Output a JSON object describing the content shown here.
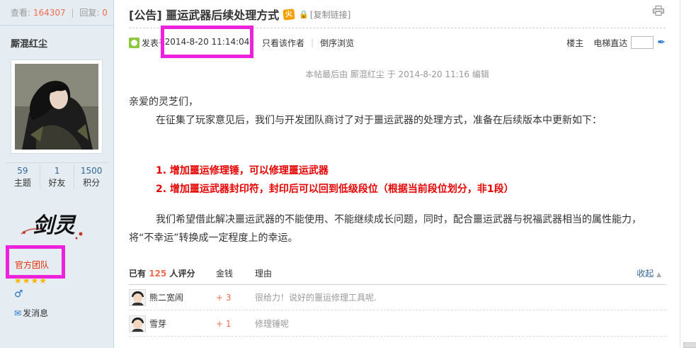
{
  "sidebar": {
    "views_label": "查看:",
    "views_value": "164307",
    "replies_label": "回复:",
    "replies_value": "0",
    "username": "厮混红尘",
    "stats": [
      {
        "value": "59",
        "label": "主题"
      },
      {
        "value": "1",
        "label": "好友"
      },
      {
        "value": "1500",
        "label": "积分"
      }
    ],
    "logo_text": "剑灵",
    "group": "官方团队",
    "stars": "★★★★",
    "gender_symbol": "♂",
    "send_message": "发消息"
  },
  "thread": {
    "title": "[公告] 噩运武器后续处理方式",
    "hot_badge": "火",
    "copy_link": "[复制链接]",
    "posted_label": "发表于",
    "post_time": "2014-8-20 11:14:04",
    "only_author": "只看该作者",
    "reverse_order": "倒序浏览",
    "floor_label": "楼主",
    "elevator_label": "电梯直达",
    "edit_note": "本帖最后由 厮混红尘 于 2014-8-20 11:16 编辑"
  },
  "post": {
    "greeting": "亲爱的灵芝们，",
    "para1": "在征集了玩家意见后，我们与开发团队商讨了对于噩运武器的处理方式，准备在后续版本中更新如下：",
    "items": [
      "1. 增加噩运修理锤，可以修理噩运武器",
      "2. 增加噩运武器封印符，封印后可以回到低级段位（根据当前段位划分，非1段）"
    ],
    "para2": "我们希望借此解决噩运武器的不能使用、不能继续成长问题，同时，配合噩运武器与祝福武器相当的属性能力，将“不幸运”转换成一定程度上的幸运。"
  },
  "ratings": {
    "prefix": "已有",
    "count": "125",
    "suffix": "人评分",
    "col_money": "金钱",
    "col_reason": "理由",
    "collapse": "收起",
    "rows": [
      {
        "user": "熊二宽闹",
        "money": "+ 3",
        "reason": "很给力！说好的噩运修理工具呢."
      },
      {
        "user": "雪芽",
        "money": "+ 1",
        "reason": "修理锤呢"
      }
    ]
  },
  "colors": {
    "highlight_border": "#ee22dd",
    "announcement_red": "#e60000",
    "number_orange": "#f26c4f",
    "link_blue": "#336699"
  }
}
